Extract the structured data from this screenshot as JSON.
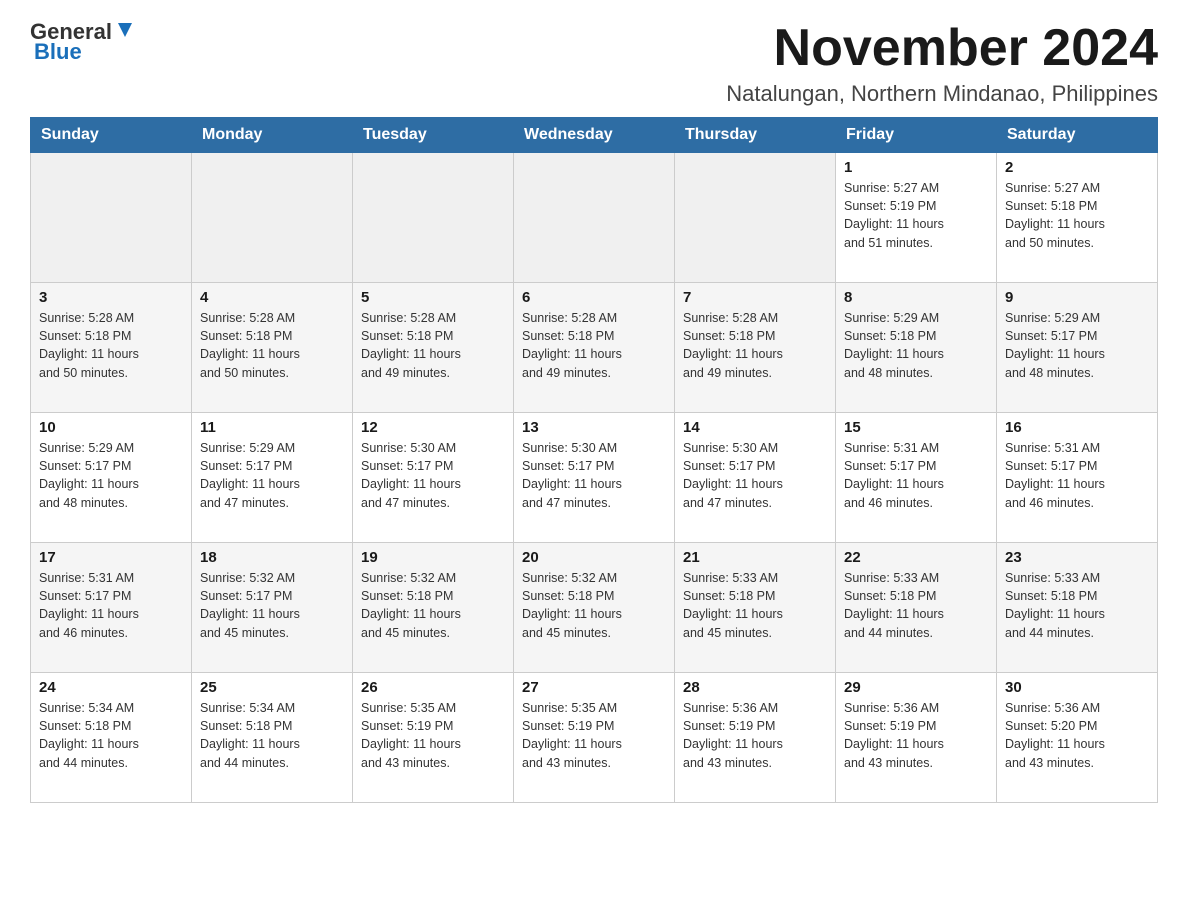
{
  "logo": {
    "text_general": "General",
    "text_blue": "Blue"
  },
  "title": "November 2024",
  "subtitle": "Natalungan, Northern Mindanao, Philippines",
  "headers": [
    "Sunday",
    "Monday",
    "Tuesday",
    "Wednesday",
    "Thursday",
    "Friday",
    "Saturday"
  ],
  "weeks": [
    [
      {
        "day": "",
        "info": ""
      },
      {
        "day": "",
        "info": ""
      },
      {
        "day": "",
        "info": ""
      },
      {
        "day": "",
        "info": ""
      },
      {
        "day": "",
        "info": ""
      },
      {
        "day": "1",
        "info": "Sunrise: 5:27 AM\nSunset: 5:19 PM\nDaylight: 11 hours\nand 51 minutes."
      },
      {
        "day": "2",
        "info": "Sunrise: 5:27 AM\nSunset: 5:18 PM\nDaylight: 11 hours\nand 50 minutes."
      }
    ],
    [
      {
        "day": "3",
        "info": "Sunrise: 5:28 AM\nSunset: 5:18 PM\nDaylight: 11 hours\nand 50 minutes."
      },
      {
        "day": "4",
        "info": "Sunrise: 5:28 AM\nSunset: 5:18 PM\nDaylight: 11 hours\nand 50 minutes."
      },
      {
        "day": "5",
        "info": "Sunrise: 5:28 AM\nSunset: 5:18 PM\nDaylight: 11 hours\nand 49 minutes."
      },
      {
        "day": "6",
        "info": "Sunrise: 5:28 AM\nSunset: 5:18 PM\nDaylight: 11 hours\nand 49 minutes."
      },
      {
        "day": "7",
        "info": "Sunrise: 5:28 AM\nSunset: 5:18 PM\nDaylight: 11 hours\nand 49 minutes."
      },
      {
        "day": "8",
        "info": "Sunrise: 5:29 AM\nSunset: 5:18 PM\nDaylight: 11 hours\nand 48 minutes."
      },
      {
        "day": "9",
        "info": "Sunrise: 5:29 AM\nSunset: 5:17 PM\nDaylight: 11 hours\nand 48 minutes."
      }
    ],
    [
      {
        "day": "10",
        "info": "Sunrise: 5:29 AM\nSunset: 5:17 PM\nDaylight: 11 hours\nand 48 minutes."
      },
      {
        "day": "11",
        "info": "Sunrise: 5:29 AM\nSunset: 5:17 PM\nDaylight: 11 hours\nand 47 minutes."
      },
      {
        "day": "12",
        "info": "Sunrise: 5:30 AM\nSunset: 5:17 PM\nDaylight: 11 hours\nand 47 minutes."
      },
      {
        "day": "13",
        "info": "Sunrise: 5:30 AM\nSunset: 5:17 PM\nDaylight: 11 hours\nand 47 minutes."
      },
      {
        "day": "14",
        "info": "Sunrise: 5:30 AM\nSunset: 5:17 PM\nDaylight: 11 hours\nand 47 minutes."
      },
      {
        "day": "15",
        "info": "Sunrise: 5:31 AM\nSunset: 5:17 PM\nDaylight: 11 hours\nand 46 minutes."
      },
      {
        "day": "16",
        "info": "Sunrise: 5:31 AM\nSunset: 5:17 PM\nDaylight: 11 hours\nand 46 minutes."
      }
    ],
    [
      {
        "day": "17",
        "info": "Sunrise: 5:31 AM\nSunset: 5:17 PM\nDaylight: 11 hours\nand 46 minutes."
      },
      {
        "day": "18",
        "info": "Sunrise: 5:32 AM\nSunset: 5:17 PM\nDaylight: 11 hours\nand 45 minutes."
      },
      {
        "day": "19",
        "info": "Sunrise: 5:32 AM\nSunset: 5:18 PM\nDaylight: 11 hours\nand 45 minutes."
      },
      {
        "day": "20",
        "info": "Sunrise: 5:32 AM\nSunset: 5:18 PM\nDaylight: 11 hours\nand 45 minutes."
      },
      {
        "day": "21",
        "info": "Sunrise: 5:33 AM\nSunset: 5:18 PM\nDaylight: 11 hours\nand 45 minutes."
      },
      {
        "day": "22",
        "info": "Sunrise: 5:33 AM\nSunset: 5:18 PM\nDaylight: 11 hours\nand 44 minutes."
      },
      {
        "day": "23",
        "info": "Sunrise: 5:33 AM\nSunset: 5:18 PM\nDaylight: 11 hours\nand 44 minutes."
      }
    ],
    [
      {
        "day": "24",
        "info": "Sunrise: 5:34 AM\nSunset: 5:18 PM\nDaylight: 11 hours\nand 44 minutes."
      },
      {
        "day": "25",
        "info": "Sunrise: 5:34 AM\nSunset: 5:18 PM\nDaylight: 11 hours\nand 44 minutes."
      },
      {
        "day": "26",
        "info": "Sunrise: 5:35 AM\nSunset: 5:19 PM\nDaylight: 11 hours\nand 43 minutes."
      },
      {
        "day": "27",
        "info": "Sunrise: 5:35 AM\nSunset: 5:19 PM\nDaylight: 11 hours\nand 43 minutes."
      },
      {
        "day": "28",
        "info": "Sunrise: 5:36 AM\nSunset: 5:19 PM\nDaylight: 11 hours\nand 43 minutes."
      },
      {
        "day": "29",
        "info": "Sunrise: 5:36 AM\nSunset: 5:19 PM\nDaylight: 11 hours\nand 43 minutes."
      },
      {
        "day": "30",
        "info": "Sunrise: 5:36 AM\nSunset: 5:20 PM\nDaylight: 11 hours\nand 43 minutes."
      }
    ]
  ]
}
